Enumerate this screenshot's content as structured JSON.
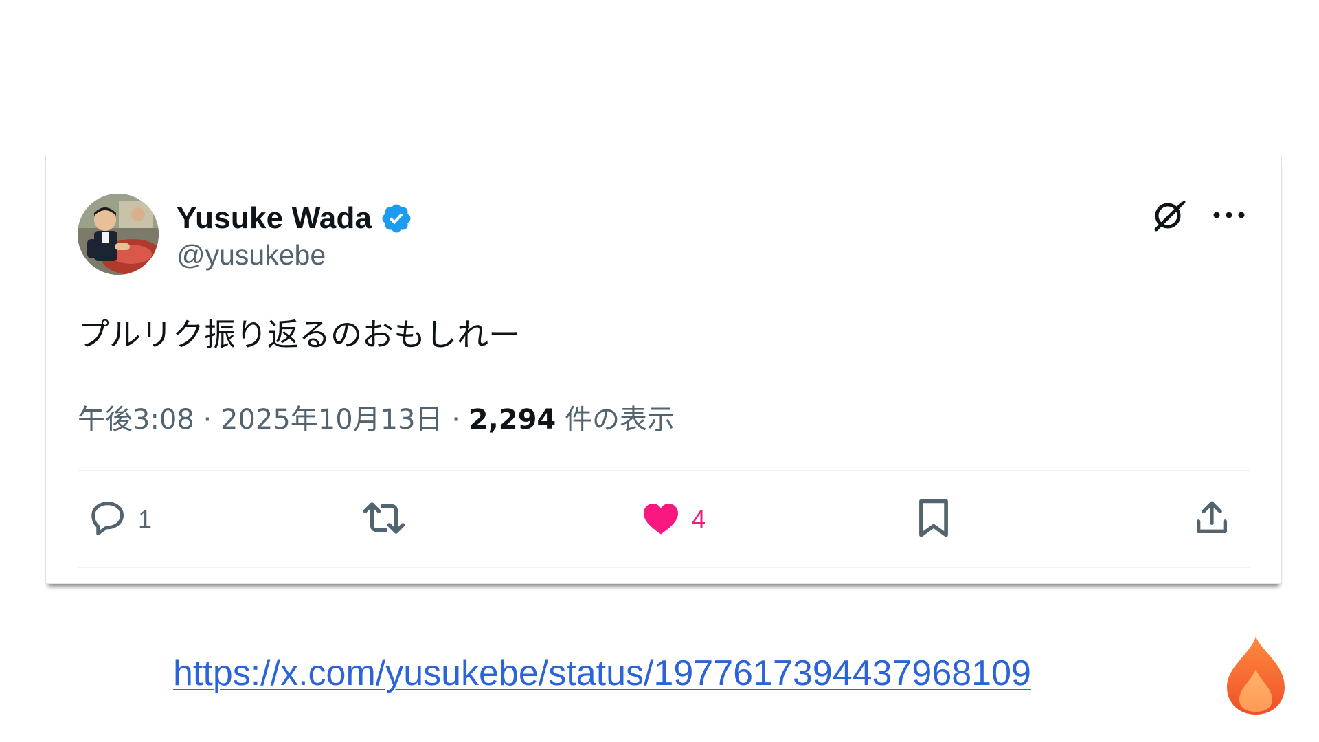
{
  "tweet": {
    "author": {
      "display_name": "Yusuke Wada",
      "handle": "@yusukebe",
      "verified": true,
      "avatar": "avatar-photo"
    },
    "text": "プルリク振り返るのおもしれー",
    "meta": {
      "time": "午後3:08",
      "separator": "·",
      "date": "2025年10月13日",
      "views_count": "2,294",
      "views_label": "件の表示"
    },
    "top_actions": {
      "grok_icon": "grok-icon",
      "more_icon": "more-icon"
    },
    "actions": {
      "reply": {
        "icon": "reply-icon",
        "count": "1"
      },
      "retweet": {
        "icon": "retweet-icon",
        "count": ""
      },
      "like": {
        "icon": "heart-icon",
        "count": "4",
        "liked": true
      },
      "bookmark": {
        "icon": "bookmark-icon"
      },
      "share": {
        "icon": "share-icon"
      }
    }
  },
  "link": {
    "url": "https://x.com/yusukebe/status/1977617394437968109"
  },
  "decoration": {
    "fire_icon": "fire-icon"
  },
  "colors": {
    "verified_blue": "#1d9bf0",
    "like_pink": "#f91880",
    "text_primary": "#0f1419",
    "text_secondary": "#536471",
    "link_blue": "#2b63d9"
  }
}
